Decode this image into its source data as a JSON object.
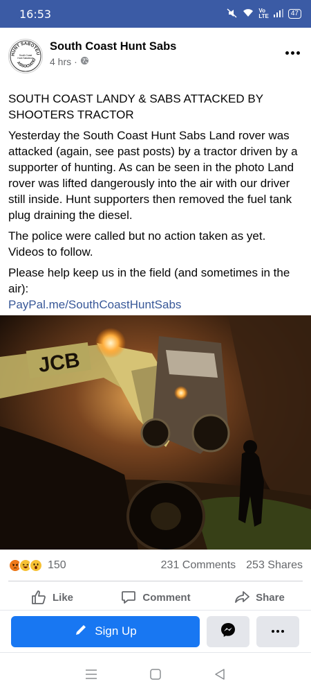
{
  "status_bar": {
    "time": "16:53",
    "battery": "47"
  },
  "post": {
    "page_name": "South Coast Hunt Sabs",
    "time_ago": "4 hrs",
    "separator": "·",
    "audience_icon": "globe-icon",
    "avatar_text_top": "HUNT SABOTEURS",
    "avatar_text_bottom": "ASSOCIATION",
    "avatar_center_line1": "South Coast",
    "avatar_center_line2": "Hunt Saboteurs",
    "headline": "SOUTH COAST LANDY & SABS ATTACKED BY SHOOTERS TRACTOR",
    "paragraph1": "Yesterday the South Coast Hunt Sabs Land rover was attacked (again, see past posts) by a tractor driven by a supporter of hunting. As can be seen in the photo Land rover was lifted dangerously into the air with our driver still inside. Hunt supporters then removed the fuel tank plug draining the diesel.",
    "paragraph2": "The police were called but no action taken as yet. Videos to follow.",
    "paragraph3": "Please help keep us in the field (and sometimes in the air):",
    "link": "PayPal.me/SouthCoastHuntSabs",
    "photo_brand": "JCB"
  },
  "engagement": {
    "reaction_icons": [
      "angry-icon",
      "laugh-icon",
      "wow-icon"
    ],
    "reaction_count": "150",
    "comments": "231 Comments",
    "shares": "253 Shares"
  },
  "actions": {
    "like": "Like",
    "comment": "Comment",
    "share": "Share"
  },
  "cta": {
    "signup": "Sign Up"
  },
  "colors": {
    "status_bar": "#3b5ba5",
    "primary": "#1877f2",
    "link": "#385898",
    "muted": "#65676b"
  }
}
